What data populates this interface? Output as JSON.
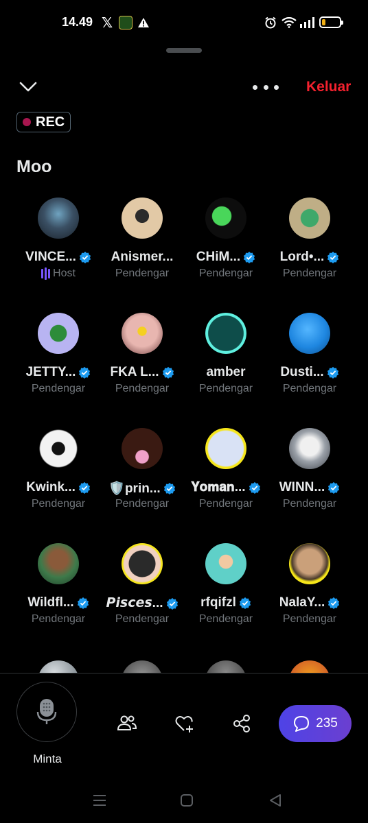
{
  "status_bar": {
    "time": "14.49",
    "battery_level": 0.2,
    "battery_color": "#f2b015"
  },
  "header": {
    "leave_label": "Keluar",
    "leave_color": "#f4212e"
  },
  "rec_badge": "REC",
  "space_title": "Moo",
  "participants": [
    {
      "name": "VINCE...",
      "role": "Host",
      "verified": true,
      "avatar": "robot-art"
    },
    {
      "name": "Anismer...",
      "role": "Pendengar",
      "verified": false,
      "avatar": "character-sticker"
    },
    {
      "name": "CHiM...",
      "role": "Pendengar",
      "verified": true,
      "avatar": "green-ghost-rifle"
    },
    {
      "name": "Lord•...",
      "role": "Pendengar",
      "verified": true,
      "avatar": "green-ghost-cash"
    },
    {
      "name": "JETTY...",
      "role": "Pendengar",
      "verified": true,
      "avatar": "green-dino-on-lilac"
    },
    {
      "name": "FKA L...",
      "role": "Pendengar",
      "verified": true,
      "avatar": "cat-sunglasses"
    },
    {
      "name": "amber",
      "role": "Pendengar",
      "verified": false,
      "avatar": "teal-blob-eyes"
    },
    {
      "name": "Dusti...",
      "role": "Pendengar",
      "verified": true,
      "avatar": "blue-blob"
    },
    {
      "name": "Kwink...",
      "role": "Pendengar",
      "verified": true,
      "avatar": "white-furry-mask"
    },
    {
      "name": "🛡️prin...",
      "role": "Pendengar",
      "verified": true,
      "avatar": "woman-pink-dress"
    },
    {
      "name": "𝐘𝐨𝐦𝐚𝐧...",
      "role": "Pendengar",
      "verified": true,
      "avatar": "anime-sunglasses-yellow-ring"
    },
    {
      "name": "WINN...",
      "role": "Pendengar",
      "verified": true,
      "avatar": "white-hair-anime"
    },
    {
      "name": "Wildfl...",
      "role": "Pendengar",
      "verified": true,
      "avatar": "hijab-illustration"
    },
    {
      "name": "𝙋𝙞𝙨𝙘𝙚𝙨...",
      "role": "Pendengar",
      "verified": true,
      "avatar": "anime-girl-yellow-ring"
    },
    {
      "name": "rfqifzl",
      "role": "Pendengar",
      "verified": true,
      "avatar": "cartoon-boy-sign"
    },
    {
      "name": "NalaY...",
      "role": "Pendengar",
      "verified": true,
      "avatar": "woman-portrait-yellow-ring"
    }
  ],
  "bottom_bar": {
    "mic_label": "Minta",
    "comment_count": "235",
    "accent": "#5a3fd6"
  },
  "colors": {
    "verified": "#1d9bf0",
    "host_bars": "#7856ff",
    "muted_text": "#71767b"
  }
}
